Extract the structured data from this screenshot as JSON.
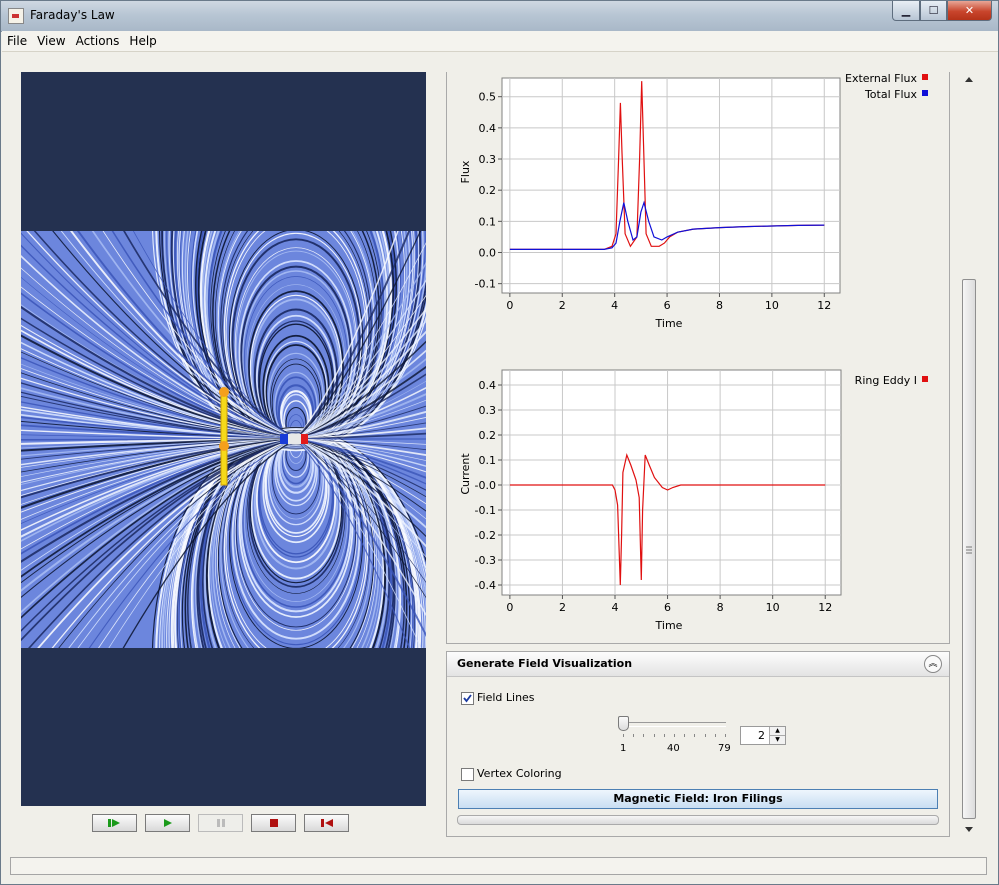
{
  "window": {
    "title": "Faraday's Law"
  },
  "menu": [
    "File",
    "View",
    "Actions",
    "Help"
  ],
  "flux_chart": {
    "ylabel": "Flux",
    "xlabel": "Time",
    "xticks": [
      "0",
      "2",
      "4",
      "6",
      "8",
      "10",
      "12"
    ],
    "yticks": [
      "0.5",
      "0.4",
      "0.3",
      "0.2",
      "0.1",
      "0.0",
      "-0.1"
    ],
    "legend": [
      {
        "label": "External Flux",
        "color": "#e01010"
      },
      {
        "label": "Total Flux",
        "color": "#1010d8"
      }
    ]
  },
  "current_chart": {
    "ylabel": "Current",
    "xlabel": "Time",
    "xticks": [
      "0",
      "2",
      "4",
      "6",
      "8",
      "10",
      "12"
    ],
    "yticks": [
      "0.4",
      "0.3",
      "0.2",
      "0.1",
      "-0.0",
      "-0.1",
      "-0.2",
      "-0.3",
      "-0.4"
    ],
    "legend": [
      {
        "label": "Ring  Eddy  I",
        "color": "#e01010"
      }
    ]
  },
  "chart_data": [
    {
      "type": "line",
      "xlabel": "Time",
      "ylabel": "Flux",
      "xlim": [
        -0.3,
        12.6
      ],
      "ylim": [
        -0.13,
        0.56
      ],
      "grid": true,
      "legend_position": "top-right",
      "series": [
        {
          "name": "External Flux",
          "color": "#e01010",
          "x": [
            0,
            3.6,
            3.9,
            4.05,
            4.15,
            4.22,
            4.28,
            4.4,
            4.6,
            4.85,
            4.95,
            5.03,
            5.1,
            5.2,
            5.4,
            5.7,
            5.9,
            6.1,
            6.4,
            7,
            8,
            9,
            10,
            11,
            12
          ],
          "y": [
            0.01,
            0.01,
            0.02,
            0.06,
            0.3,
            0.48,
            0.32,
            0.06,
            0.02,
            0.05,
            0.3,
            0.55,
            0.35,
            0.06,
            0.02,
            0.02,
            0.03,
            0.05,
            0.065,
            0.075,
            0.08,
            0.083,
            0.085,
            0.087,
            0.088
          ]
        },
        {
          "name": "Total Flux",
          "color": "#1010d8",
          "x": [
            0,
            3.6,
            3.9,
            4.05,
            4.2,
            4.35,
            4.5,
            4.7,
            4.85,
            5.0,
            5.12,
            5.3,
            5.5,
            5.8,
            6.0,
            6.4,
            7,
            8,
            9,
            10,
            11,
            12
          ],
          "y": [
            0.01,
            0.01,
            0.015,
            0.03,
            0.1,
            0.16,
            0.1,
            0.04,
            0.05,
            0.13,
            0.16,
            0.1,
            0.05,
            0.04,
            0.05,
            0.065,
            0.075,
            0.08,
            0.083,
            0.085,
            0.087,
            0.088
          ]
        }
      ]
    },
    {
      "type": "line",
      "xlabel": "Time",
      "ylabel": "Current",
      "xlim": [
        -0.3,
        12.6
      ],
      "ylim": [
        -0.44,
        0.46
      ],
      "grid": true,
      "legend_position": "top-right",
      "series": [
        {
          "name": "Ring  Eddy  I",
          "color": "#e01010",
          "x": [
            0,
            3.9,
            4.0,
            4.1,
            4.2,
            4.25,
            4.3,
            4.45,
            4.6,
            4.8,
            4.92,
            5.0,
            5.05,
            5.15,
            5.3,
            5.5,
            5.8,
            6.0,
            6.2,
            6.5,
            7,
            8,
            10,
            12
          ],
          "y": [
            0,
            0,
            -0.02,
            -0.08,
            -0.4,
            -0.2,
            0.05,
            0.12,
            0.08,
            0.02,
            -0.05,
            -0.38,
            -0.1,
            0.12,
            0.08,
            0.03,
            -0.01,
            -0.02,
            -0.01,
            0,
            0,
            0,
            0,
            0
          ]
        }
      ]
    }
  ],
  "field_panel": {
    "title": "Generate Field Visualization",
    "field_lines_label": "Field Lines",
    "field_lines_checked": true,
    "slider_labels": [
      "1",
      "40",
      "79"
    ],
    "slider_value": 1,
    "spinner_value": "2",
    "vertex_coloring_label": "Vertex Coloring",
    "vertex_coloring_checked": false,
    "magnetic_field_button": "Magnetic Field:  Iron Filings"
  },
  "viz": {
    "background": "#243150",
    "field_base_color": "#6c86dd"
  }
}
